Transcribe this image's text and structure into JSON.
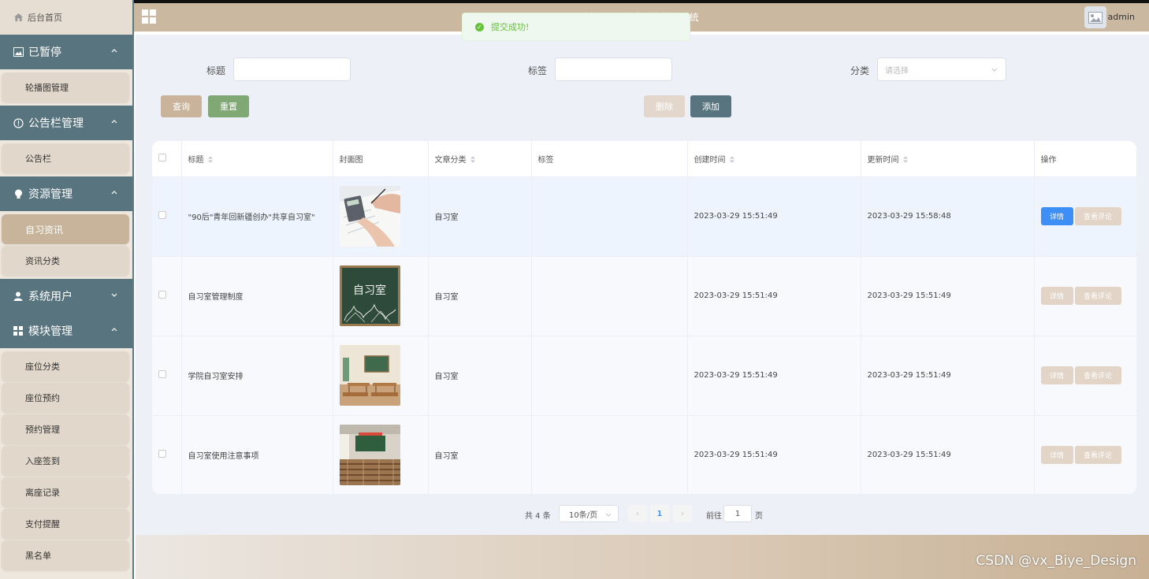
{
  "sidebar": {
    "home": "后台首页",
    "groups": [
      {
        "title": "已暂停",
        "items": [
          "轮播图管理"
        ],
        "open": true
      },
      {
        "title": "公告栏管理",
        "items": [
          "公告栏"
        ],
        "open": true
      },
      {
        "title": "资源管理",
        "items": [
          "自习资讯",
          "资讯分类"
        ],
        "open": true,
        "active": "自习资讯"
      },
      {
        "title": "系统用户",
        "items": [],
        "open": false
      },
      {
        "title": "模块管理",
        "items": [
          "座位分类",
          "座位预约",
          "预约管理",
          "入座签到",
          "离座记录",
          "支付提醒",
          "黑名单"
        ],
        "open": true
      }
    ]
  },
  "header": {
    "title": "基于Java的自习室管理系统",
    "username": "admin"
  },
  "toast": {
    "message": "提交成功!"
  },
  "filters": {
    "title_label": "标题",
    "title_value": "",
    "tag_label": "标签",
    "tag_value": "",
    "category_label": "分类",
    "category_placeholder": "请选择"
  },
  "buttons": {
    "search": "查询",
    "reset": "重置",
    "delete": "删除",
    "add": "添加"
  },
  "table": {
    "columns": [
      "标题",
      "封面图",
      "文章分类",
      "标签",
      "创建时间",
      "更新时间",
      "操作"
    ],
    "rows": [
      {
        "title": "\"90后\"青年回新疆创办\"共享自习室\"",
        "category": "自习室",
        "tag": "",
        "created": "2023-03-29 15:51:49",
        "updated": "2023-03-29 15:58:48",
        "cover": "calculator-paperwork"
      },
      {
        "title": "自习室管理制度",
        "category": "自习室",
        "tag": "",
        "created": "2023-03-29 15:51:49",
        "updated": "2023-03-29 15:51:49",
        "cover": "chalkboard-zixishi"
      },
      {
        "title": "学院自习室安排",
        "category": "自习室",
        "tag": "",
        "created": "2023-03-29 15:51:49",
        "updated": "2023-03-29 15:51:49",
        "cover": "classroom-desks"
      },
      {
        "title": "自习室使用注意事项",
        "category": "自习室",
        "tag": "",
        "created": "2023-03-29 15:51:49",
        "updated": "2023-03-29 15:51:49",
        "cover": "lecture-hall"
      }
    ],
    "detail_label": "详情",
    "comment_label": "查看评论",
    "chalkboard_text": "自习室"
  },
  "pagination": {
    "total": "共 4 条",
    "page_size": "10条/页",
    "current": "1",
    "goto_label": "前往",
    "goto_value": "1",
    "page_unit": "页",
    "prev": "‹",
    "next": "›"
  },
  "watermark": "CSDN @vx_Biye_Design",
  "colors": {
    "sidebar_group": "#58757f",
    "active_item": "#c8b49a",
    "header": "#cbb8a1",
    "primary": "#3e8ef7",
    "success": "#67c23a",
    "add_button": "#58757f",
    "reset_button": "#80a874"
  }
}
